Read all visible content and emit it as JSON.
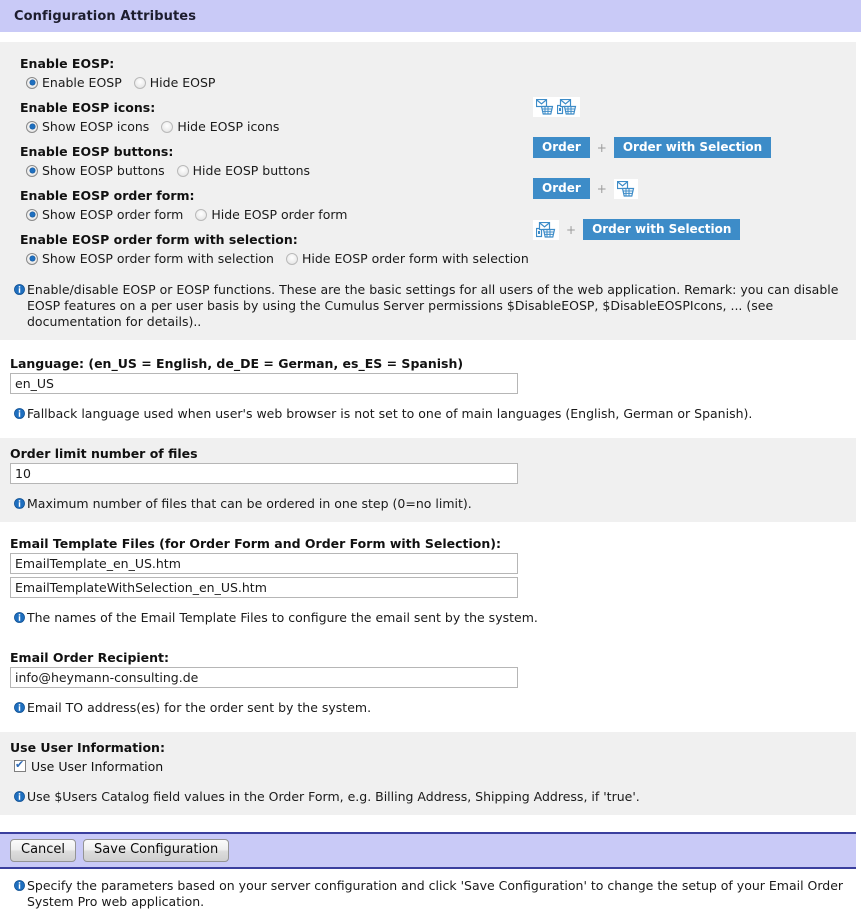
{
  "window": {
    "title": "Configuration Attributes"
  },
  "eosp": {
    "groups": [
      {
        "label": "Enable EOSP:",
        "options": [
          {
            "text": "Enable EOSP",
            "selected": true
          },
          {
            "text": "Hide EOSP",
            "selected": false
          }
        ]
      },
      {
        "label": "Enable EOSP icons:",
        "options": [
          {
            "text": "Show EOSP icons",
            "selected": true
          },
          {
            "text": "Hide EOSP icons",
            "selected": false
          }
        ]
      },
      {
        "label": "Enable EOSP buttons:",
        "options": [
          {
            "text": "Show EOSP buttons",
            "selected": true
          },
          {
            "text": "Hide EOSP buttons",
            "selected": false
          }
        ]
      },
      {
        "label": "Enable EOSP order form:",
        "options": [
          {
            "text": "Show EOSP order form",
            "selected": true
          },
          {
            "text": "Hide EOSP order form",
            "selected": false
          }
        ]
      },
      {
        "label": "Enable EOSP order form with selection:",
        "options": [
          {
            "text": "Show EOSP order form with selection",
            "selected": true
          },
          {
            "text": "Hide EOSP order form with selection",
            "selected": false
          }
        ]
      }
    ],
    "previews": {
      "icons_row": {
        "icon1": "order-basket-icon",
        "icon2": "order-basket-selection-icon"
      },
      "buttons_row": {
        "button1": "Order",
        "plus": "+",
        "button2": "Order with Selection"
      },
      "order_form_row": {
        "button1": "Order",
        "plus": "+",
        "icon": "order-basket-icon"
      },
      "order_form_selection_row": {
        "icon": "order-basket-selection-icon",
        "plus": "+",
        "button1": "Order with Selection"
      }
    },
    "note": "Enable/disable EOSP or EOSP functions. These are the basic settings for all users of the web application. Remark: you can disable EOSP features on a per user basis by using the Cumulus Server permissions $DisableEOSP, $DisableEOSPIcons, ... (see documentation for details).."
  },
  "language": {
    "label": "Language: (en_US = English, de_DE = German, es_ES = Spanish)",
    "value": "en_US",
    "placeholder": "",
    "note": "Fallback language used when user's web browser is not set to one of main languages (English, German or Spanish)."
  },
  "order_limit": {
    "label": "Order limit number of files",
    "value": "10",
    "placeholder": "",
    "note": "Maximum number of files that can be ordered in one step (0=no limit)."
  },
  "email_templates": {
    "label": "Email Template Files (for Order Form and Order Form with Selection):",
    "value1": "EmailTemplate_en_US.htm",
    "value2": "EmailTemplateWithSelection_en_US.htm",
    "placeholder": "",
    "note": "The names of the Email Template Files to configure the email sent by the system."
  },
  "email_recipient": {
    "label": "Email Order Recipient:",
    "value": "info@heymann-consulting.de",
    "placeholder": "",
    "note": "Email TO address(es) for the order sent by the system."
  },
  "user_information": {
    "label": "Use User Information:",
    "checkbox_label": "Use User Information",
    "checked": true,
    "note": "Use $Users Catalog field values in the Order Form, e.g. Billing Address, Shipping Address, if 'true'."
  },
  "footer": {
    "cancel_label": "Cancel",
    "save_label": "Save Configuration",
    "note": "Specify the parameters based on your server configuration and click 'Save Configuration' to change the setup of your Email Order System Pro web application."
  },
  "colors": {
    "header_bar": "#c9caf7",
    "accent_blue": "#3d8cc8",
    "rule": "#3a3f9e",
    "section_gray": "#f0f0f0",
    "info_icon": "#1f6fbf"
  }
}
